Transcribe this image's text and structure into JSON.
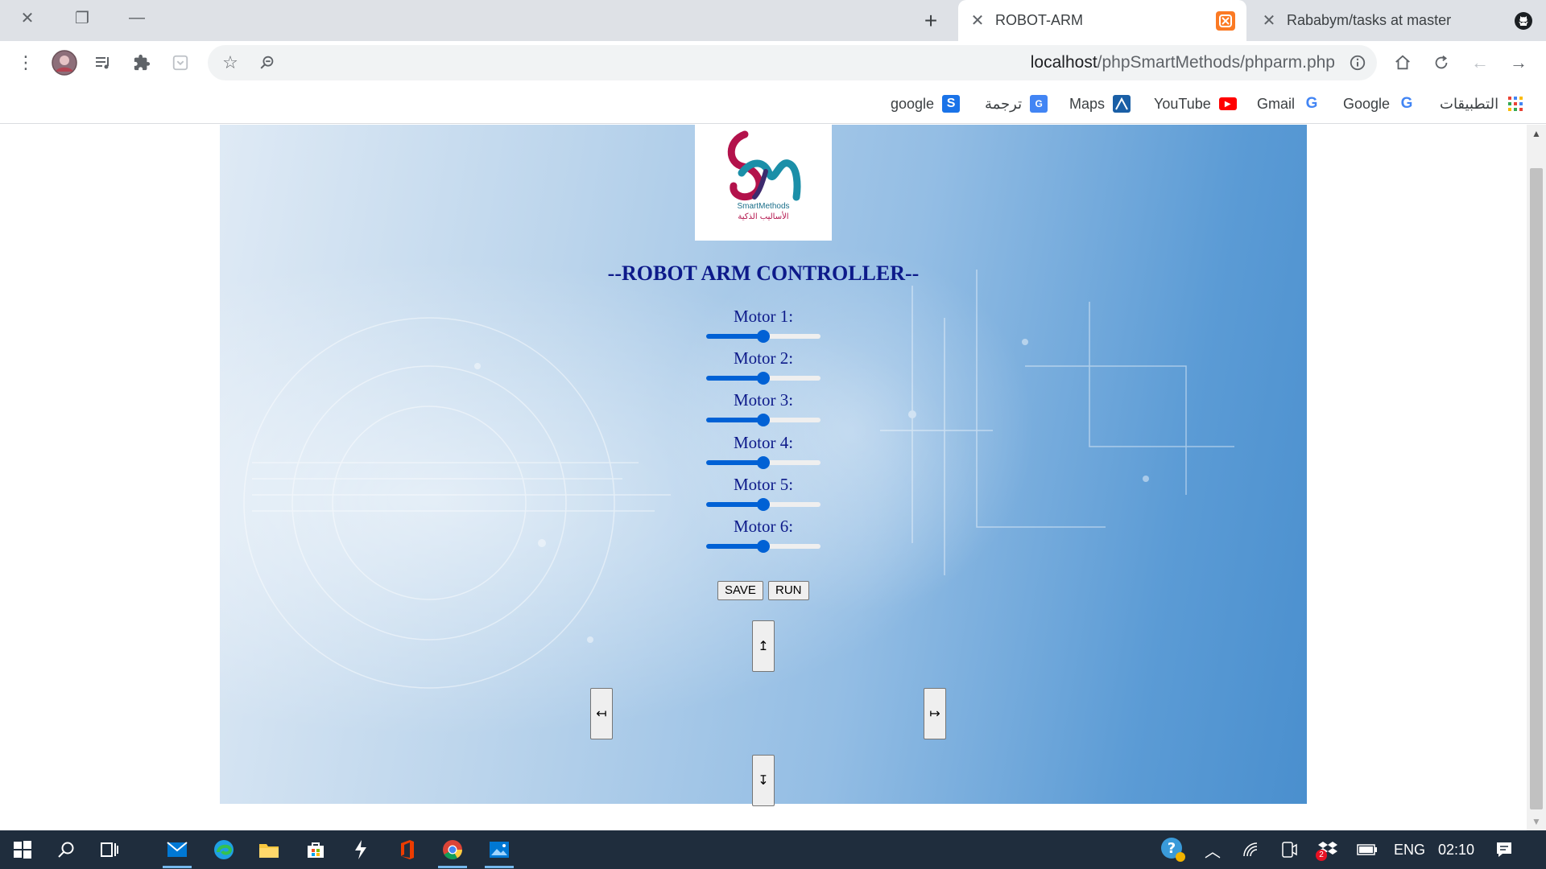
{
  "browser": {
    "window_controls": {
      "close": "✕",
      "restore": "❐",
      "minimize": "—"
    },
    "new_tab_label": "+",
    "tabs": [
      {
        "title": "ROBOT-ARM",
        "active": true,
        "favicon": "xampp-icon"
      },
      {
        "title": "Rababym/tasks at master",
        "active": false,
        "favicon": "github-icon"
      }
    ],
    "url_host": "localhost",
    "url_path": "/phpSmartMethods/phparm.php",
    "bookmarks": [
      {
        "label": "التطبيقات",
        "icon": "apps-grid-icon"
      },
      {
        "label": "Google",
        "icon": "google-icon"
      },
      {
        "label": "Gmail",
        "icon": "google-icon"
      },
      {
        "label": "YouTube",
        "icon": "youtube-icon"
      },
      {
        "label": "Maps",
        "icon": "maps-icon"
      },
      {
        "label": "ترجمة",
        "icon": "translate-icon"
      },
      {
        "label": "google",
        "icon": "s-icon"
      }
    ]
  },
  "page": {
    "logo_text_en": "SmartMethods",
    "logo_text_ar": "الأساليب الذكية",
    "title": "--ROBOT ARM CONTROLLER--",
    "motors": [
      {
        "label": "Motor 1:",
        "value": 0.5
      },
      {
        "label": "Motor 2:",
        "value": 0.5
      },
      {
        "label": "Motor 3:",
        "value": 0.5
      },
      {
        "label": "Motor 4:",
        "value": 0.5
      },
      {
        "label": "Motor 5:",
        "value": 0.5
      },
      {
        "label": "Motor 6:",
        "value": 0.5
      }
    ],
    "save_label": "SAVE",
    "run_label": "RUN",
    "arrows": {
      "up": "↥",
      "left": "↤",
      "right": "↦",
      "down": "↧"
    }
  },
  "taskbar": {
    "language": "ENG",
    "time": "02:10",
    "notification_badge": "2"
  },
  "colors": {
    "title_blue": "#0d1a8a",
    "slider_blue": "#0061d5",
    "taskbar_bg": "#1f2d3d"
  }
}
